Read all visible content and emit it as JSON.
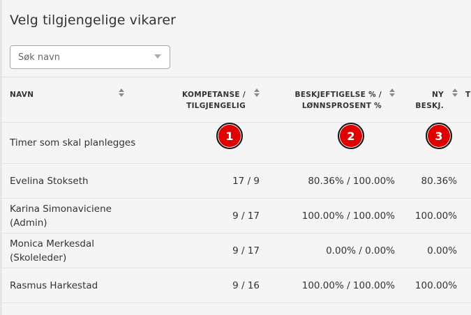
{
  "page": {
    "title": "Velg tilgjengelige vikarer"
  },
  "search": {
    "placeholder": "Søk navn"
  },
  "table": {
    "headers": {
      "name": "NAVN",
      "competence_line1": "KOMPETANSE /",
      "competence_line2": "TILGJENGELIG",
      "employment_line1": "BESKJEFTIGELSE % /",
      "employment_line2": "LØNNSPROSENT %",
      "new_line1": "NY",
      "new_line2": "BESKJ.",
      "next_partial": "T"
    },
    "plan_row": {
      "label": "Timer som skal planlegges"
    },
    "badges": [
      "1",
      "2",
      "3"
    ],
    "badge_color": "#e00000",
    "rows": [
      {
        "name_line1": "Evelina Stokseth",
        "name_line2": "",
        "competence": "17 / 9",
        "employment": "80.36% / 100.00%",
        "new": "80.36%"
      },
      {
        "name_line1": "Karina Simonaviciene",
        "name_line2": "(Admin)",
        "competence": "9 / 17",
        "employment": "100.00% / 100.00%",
        "new": "100.00%"
      },
      {
        "name_line1": "Monica Merkesdal",
        "name_line2": "(Skoleleder)",
        "competence": "9 / 17",
        "employment": "0.00% / 0.00%",
        "new": "0.00%"
      },
      {
        "name_line1": "Rasmus Harkestad",
        "name_line2": "",
        "competence": "9 / 16",
        "employment": "100.00% / 100.00%",
        "new": "100.00%"
      }
    ]
  }
}
